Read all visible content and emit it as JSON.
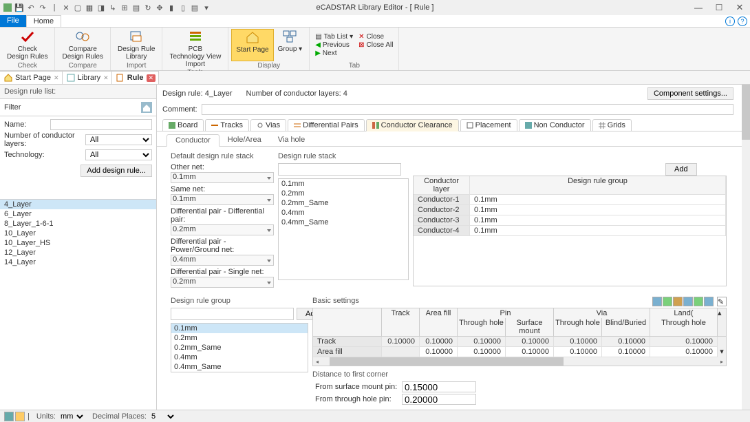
{
  "title": "eCADSTAR Library Editor - [ Rule ]",
  "menu": {
    "file": "File",
    "home": "Home"
  },
  "ribbon": {
    "check": "Check\nDesign Rules",
    "compare_dr": "Compare\nDesign Rules",
    "dr_library": "Design Rule\nLibrary",
    "pcb_tech": "PCB\nTechnology View\nImport",
    "grp_check": "Check",
    "grp_compare": "Compare",
    "grp_import": "Import",
    "grp_tools": "Tools",
    "start_page": "Start Page",
    "group": "Group",
    "grp_display": "Display",
    "tab_list": "Tab List",
    "close": "Close",
    "previous": "Previous",
    "next": "Next",
    "close_all": "Close All",
    "grp_tab": "Tab"
  },
  "doc_tabs": {
    "start": "Start Page",
    "library": "Library",
    "rule": "Rule"
  },
  "sidebar": {
    "title": "Design rule list:",
    "filter": "Filter",
    "name": "Name:",
    "layers": "Number of conductor layers:",
    "tech": "Technology:",
    "all": "All",
    "add": "Add design rule...",
    "items": [
      "4_Layer",
      "6_Layer",
      "8_Layer_1-6-1",
      "10_Layer",
      "10_Layer_HS",
      "12_Layer",
      "14_Layer"
    ]
  },
  "content": {
    "dr_label": "Design rule:",
    "dr_value": "4_Layer",
    "ncl_label": "Number of conductor layers:",
    "ncl_value": "4",
    "comp_settings": "Component settings...",
    "comment": "Comment:",
    "tabs": [
      "Board",
      "Tracks",
      "Vias",
      "Differential Pairs",
      "Conductor Clearance",
      "Placement",
      "Non Conductor",
      "Grids"
    ],
    "active_tab": 4,
    "subtabs": [
      "Conductor",
      "Hole/Area",
      "Via hole"
    ],
    "default_stack": {
      "title": "Default design rule stack",
      "other_net": "Other net:",
      "other_net_v": "0.1mm",
      "same_net": "Same net:",
      "same_net_v": "0.1mm",
      "dp_dp": "Differential pair - Differential pair:",
      "dp_dp_v": "0.2mm",
      "dp_pg": "Differential pair - Power/Ground net:",
      "dp_pg_v": "0.4mm",
      "dp_sn": "Differential pair - Single net:",
      "dp_sn_v": "0.2mm"
    },
    "stack": {
      "title": "Design rule stack",
      "add": "Add",
      "items": [
        "0.1mm",
        "0.2mm",
        "0.2mm_Same",
        "0.4mm",
        "0.4mm_Same"
      ]
    },
    "cond_grid": {
      "h1": "Conductor layer",
      "h2": "Design rule group",
      "rows": [
        {
          "l": "Conductor-1",
          "v": "0.1mm"
        },
        {
          "l": "Conductor-2",
          "v": "0.1mm"
        },
        {
          "l": "Conductor-3",
          "v": "0.1mm"
        },
        {
          "l": "Conductor-4",
          "v": "0.1mm"
        }
      ]
    },
    "drg": {
      "title": "Design rule group",
      "add": "Add",
      "items": [
        "0.1mm",
        "0.2mm",
        "0.2mm_Same",
        "0.4mm",
        "0.4mm_Same"
      ]
    },
    "basic": {
      "title": "Basic settings",
      "h_track": "Track",
      "h_areafill": "Area fill",
      "h_pin": "Pin",
      "h_via": "Via",
      "h_land": "Land(",
      "sh_th": "Through hole",
      "sh_sm": "Surface mount",
      "sh_th2": "Through hole",
      "sh_bb": "Blind/Buried",
      "sh_th3": "Through hole",
      "rows": [
        {
          "n": "Track",
          "v": [
            "0.10000",
            "0.10000",
            "0.10000",
            "0.10000",
            "0.10000",
            "0.10000",
            "0.10000"
          ]
        },
        {
          "n": "Area fill",
          "v": [
            "",
            "0.10000",
            "0.10000",
            "0.10000",
            "0.10000",
            "0.10000",
            "0.10000"
          ]
        }
      ]
    },
    "dist": {
      "title": "Distance to first corner",
      "sm": "From surface mount pin:",
      "sm_v": "0.15000",
      "th": "From through hole pin:",
      "th_v": "0.20000"
    }
  },
  "status": {
    "units": "Units:",
    "units_v": "mm",
    "dp": "Decimal Places:",
    "dp_v": "5"
  }
}
